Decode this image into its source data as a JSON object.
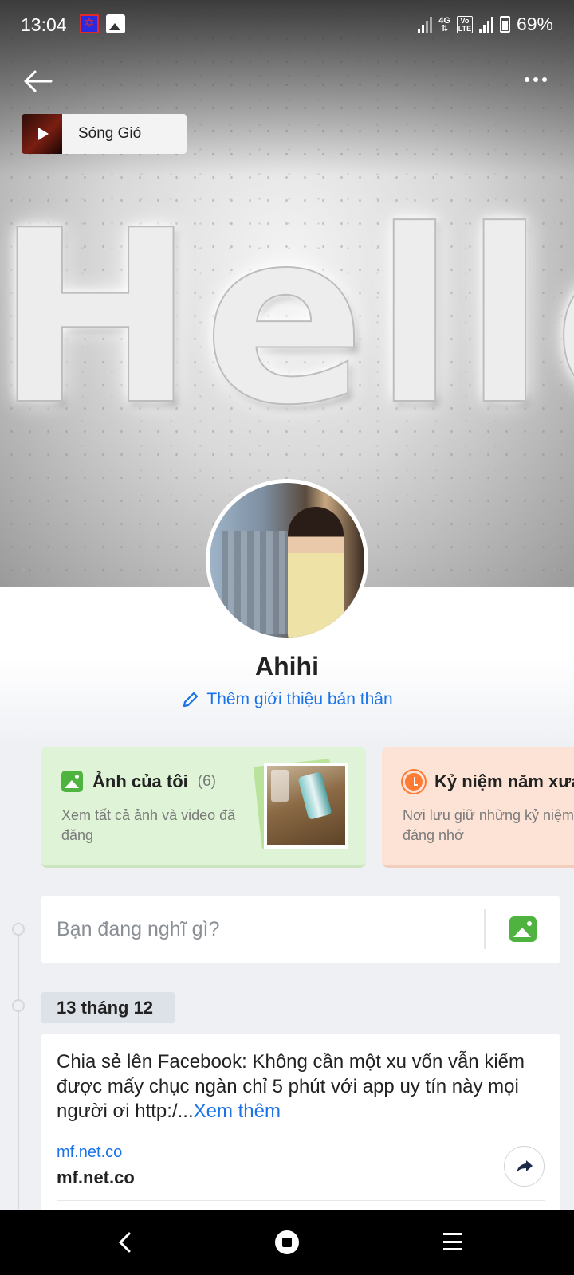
{
  "status_bar": {
    "time": "13:04",
    "battery": "69%",
    "network": "4G",
    "volte": "Vo LTE"
  },
  "cover": {
    "sign_text": "Hello!"
  },
  "music": {
    "title": "Sóng Gió"
  },
  "profile": {
    "name": "Ahihi",
    "bio_link": "Thêm giới thiệu bản thân"
  },
  "cards": {
    "photos": {
      "title": "Ảnh của tôi",
      "count": "(6)",
      "subtitle": "Xem tất cả ảnh và video đã đăng"
    },
    "memories": {
      "title": "Kỷ niệm năm xưa",
      "subtitle": "Nơi lưu giữ những kỷ niệm đáng nhớ"
    }
  },
  "composer": {
    "placeholder": "Bạn đang nghĩ gì?"
  },
  "timeline": {
    "date": "13 tháng 12",
    "post": {
      "text": "Chia sẻ lên Facebook: Không cần một xu vốn vẫn kiếm được mấy chục ngàn chỉ 5 phút với app uy tín này mọi người ơi http:/...",
      "more": "Xem thêm",
      "link_domain": "mf.net.co",
      "link_title": "mf.net.co"
    }
  },
  "colors": {
    "accent": "#1a73e8",
    "photos_card": "#dff3d6",
    "memories_card": "#fde3d6",
    "icon_green": "#4fb340",
    "icon_orange": "#ff7a33"
  },
  "icons": {
    "back": "arrow-left-icon",
    "more": "more-dots-icon",
    "edit": "pencil-icon",
    "photos": "image-icon",
    "memories": "clock-icon",
    "share": "share-icon"
  }
}
